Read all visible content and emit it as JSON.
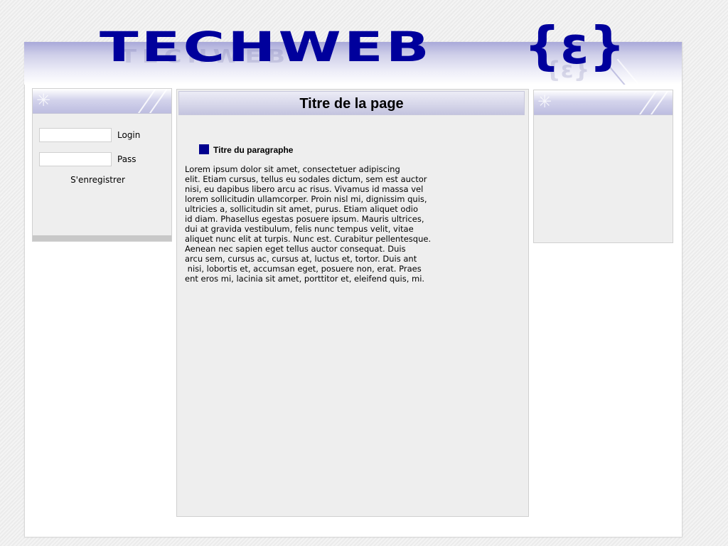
{
  "header": {
    "logo_text": "TECHWEB",
    "logo_mark": "{ε}",
    "colors": {
      "logo": "#00009c",
      "band": "#a9a9d9"
    }
  },
  "login": {
    "login_label": "Login",
    "login_value": "",
    "pass_label": "Pass",
    "pass_value": "",
    "register_label": "S'enregistrer"
  },
  "main": {
    "page_title": "Titre de la page",
    "paragraph_title": "Titre du paragraphe",
    "paragraph_text": "Lorem ipsum dolor sit amet, consectetuer adipiscing\nelit. Etiam cursus, tellus eu sodales dictum, sem est auctor\nnisi, eu dapibus libero arcu ac risus. Vivamus id massa vel\nlorem sollicitudin ullamcorper. Proin nisl mi, dignissim quis,\nultricies a, sollicitudin sit amet, purus. Etiam aliquet odio\nid diam. Phasellus egestas posuere ipsum. Mauris ultrices,\ndui at gravida vestibulum, felis nunc tempus velit, vitae\naliquet nunc elit at turpis. Nunc est. Curabitur pellentesque.\nAenean nec sapien eget tellus auctor consequat. Duis\narcu sem, cursus ac, cursus at, luctus et, tortor. Duis ant\n nisi, lobortis et, accumsan eget, posuere non, erat. Praes\nent eros mi, lacinia sit amet, porttitor et, eleifend quis, mi.",
    "bullet_color": "#00008e"
  },
  "icons": {
    "panel_decoration": "sparkle-icon",
    "paragraph_bullet": "square-bullet-icon"
  }
}
